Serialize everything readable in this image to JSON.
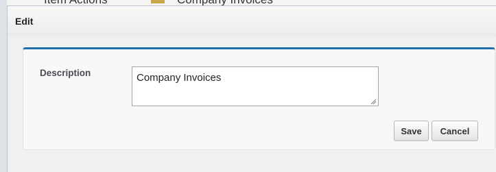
{
  "background": {
    "left_text": "Item Actions",
    "folder_name": "Company Invoices"
  },
  "dialog": {
    "title": "Edit",
    "fields": {
      "description": {
        "label": "Description",
        "value": "Company Invoices"
      }
    },
    "buttons": {
      "save_label": "Save",
      "cancel_label": "Cancel"
    }
  },
  "colors": {
    "accent": "#1f6faa",
    "panel_bg": "#f8f8f8",
    "dialog_bg": "#f0f0f0"
  }
}
